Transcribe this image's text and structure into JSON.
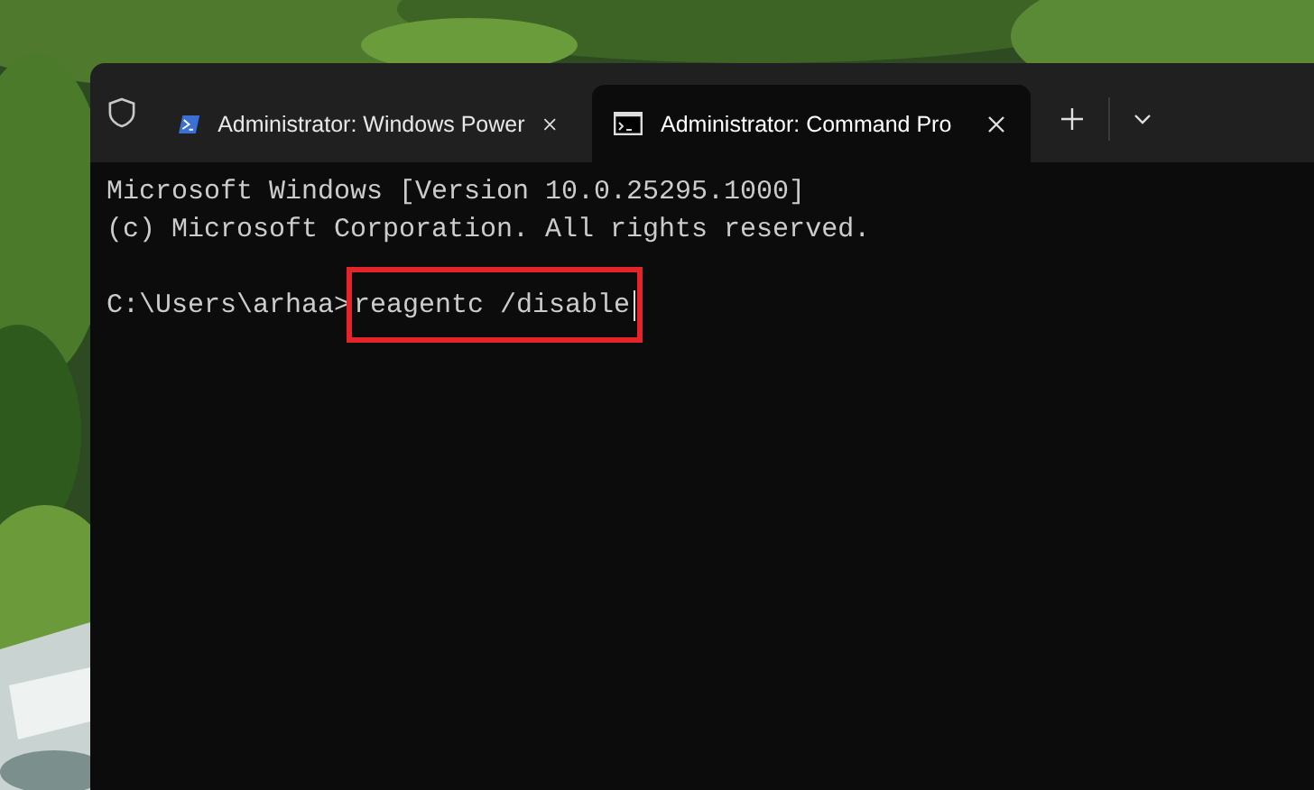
{
  "tabs": [
    {
      "kind": "powershell",
      "label": "Administrator: Windows Power",
      "selected": false
    },
    {
      "kind": "cmd",
      "label": "Administrator: Command Pro",
      "selected": true
    }
  ],
  "console": {
    "lines": [
      "Microsoft Windows [Version 10.0.25295.1000]",
      "(c) Microsoft Corporation. All rights reserved."
    ],
    "prompt": "C:\\Users\\arhaa>",
    "command": "reagentc /disable",
    "highlighted": true
  }
}
